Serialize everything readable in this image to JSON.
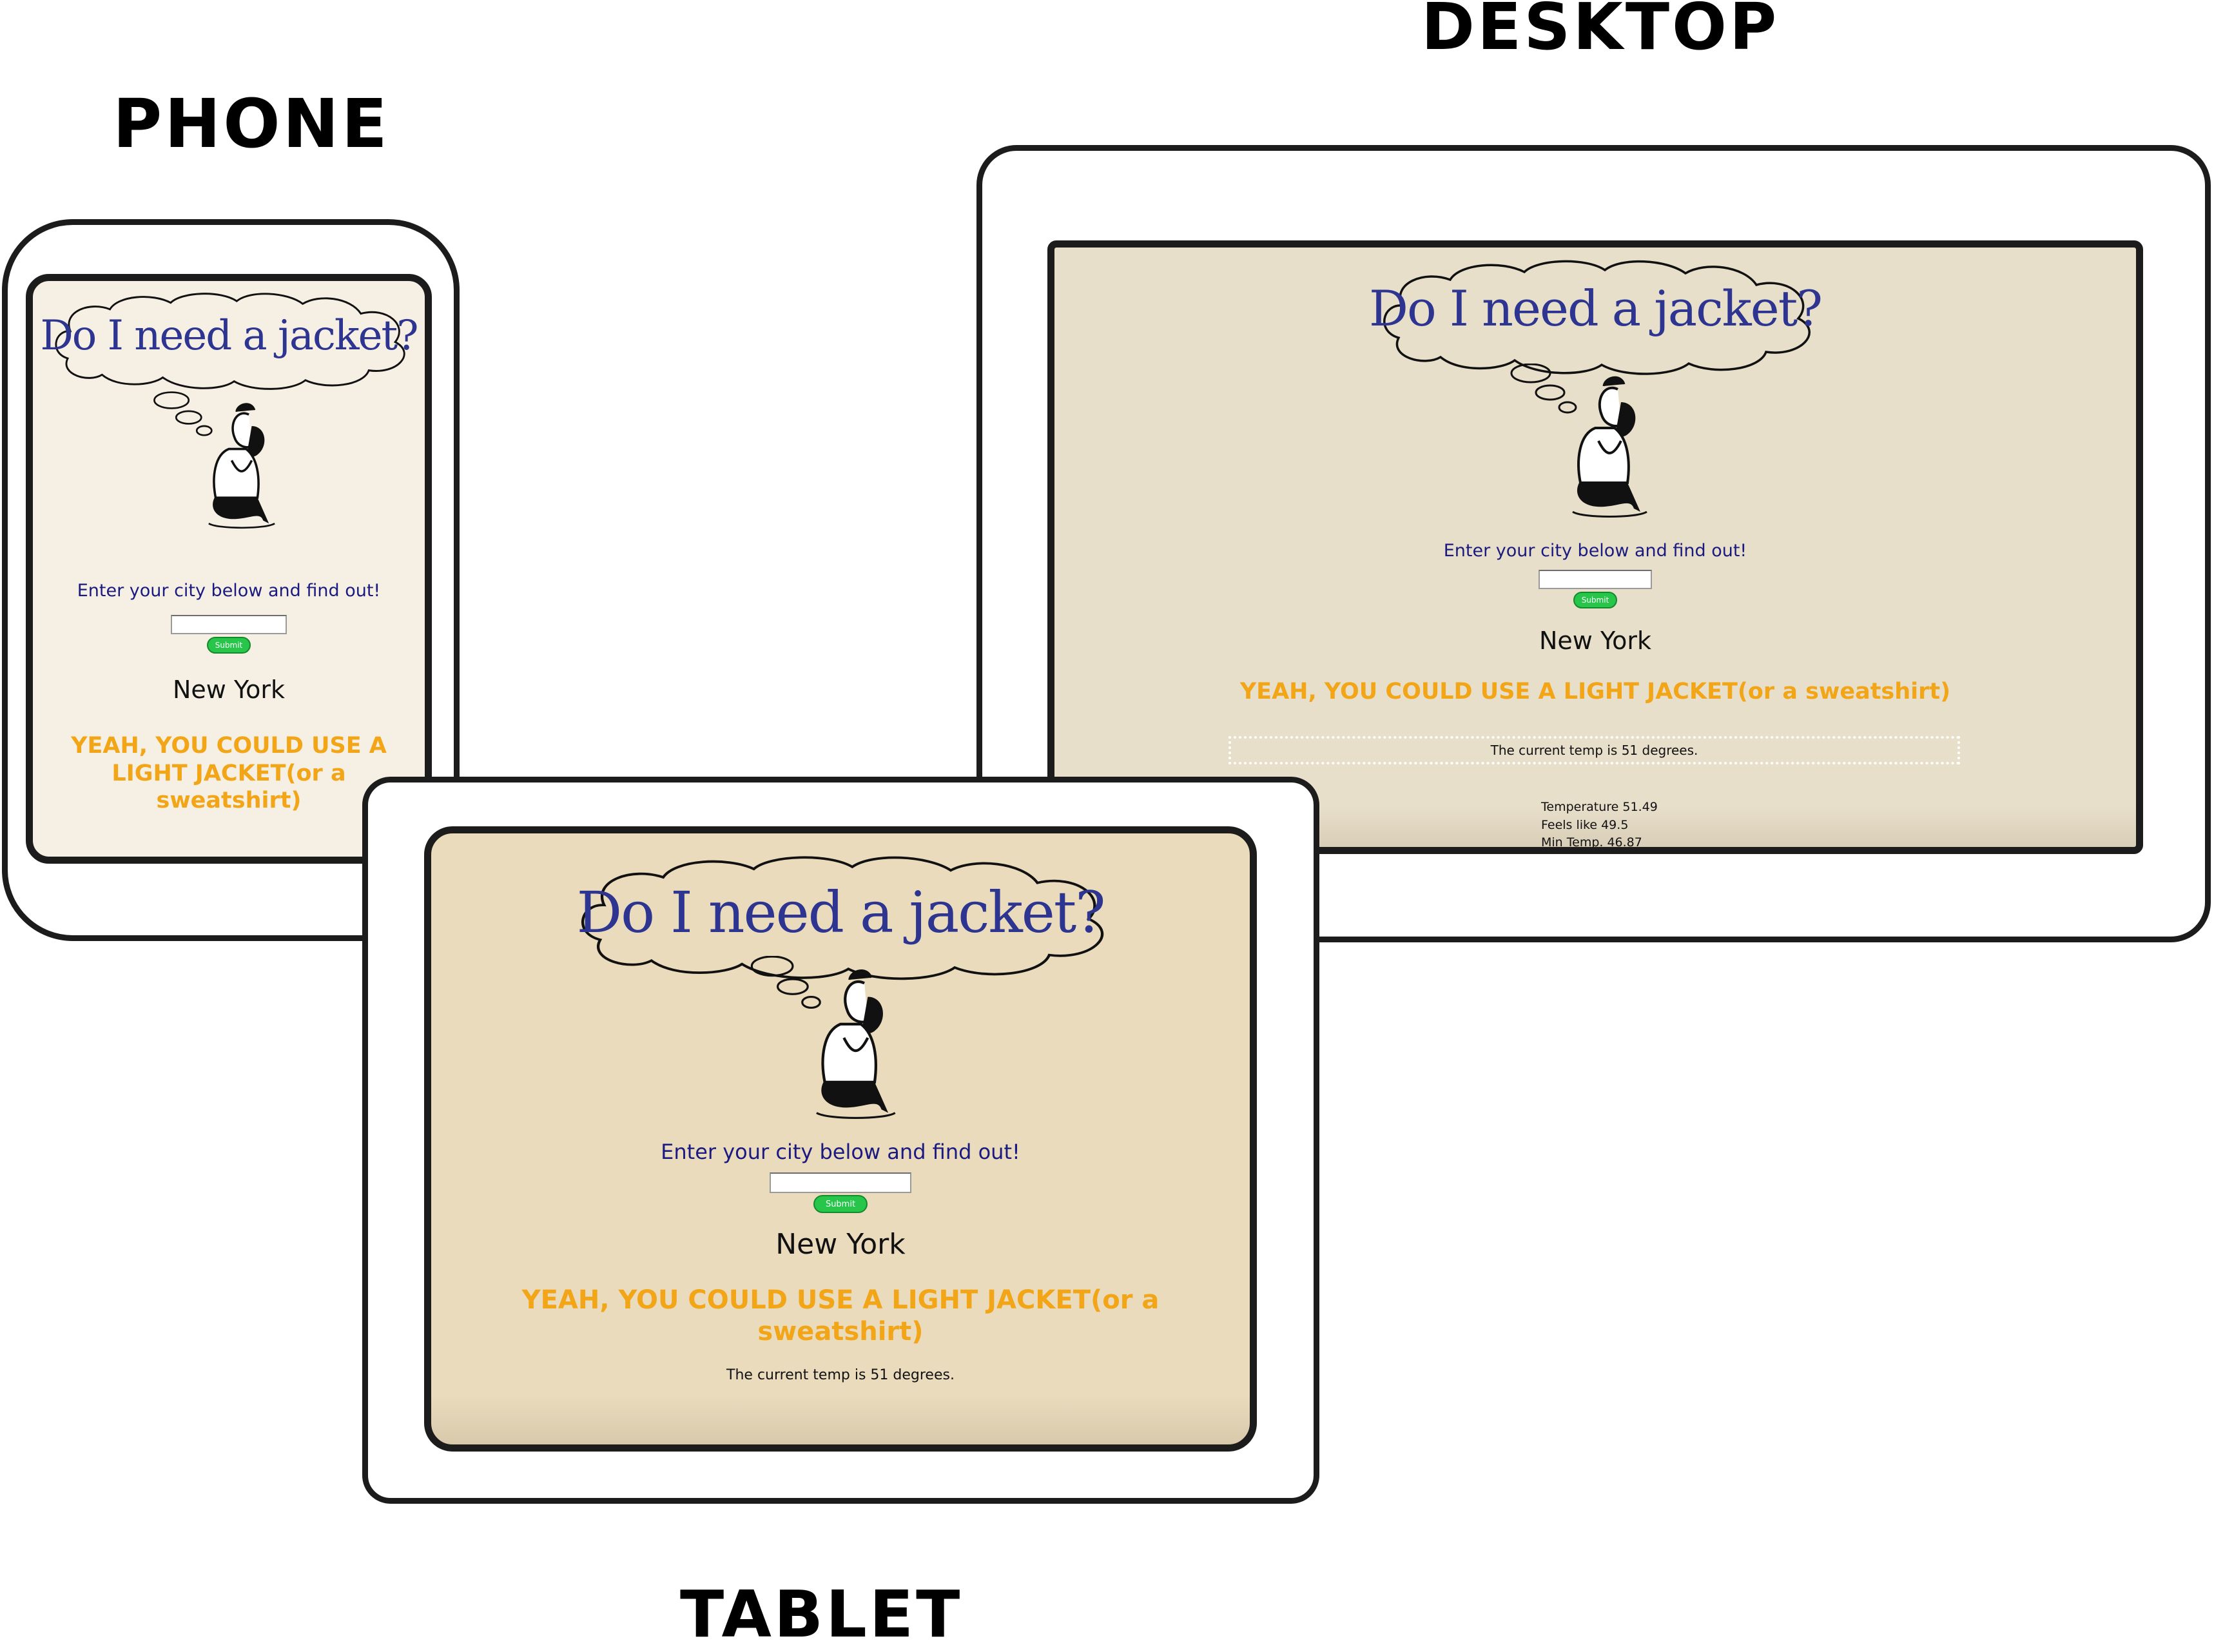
{
  "labels": {
    "phone": "PHONE",
    "desktop": "DESKTOP",
    "tablet": "TABLET"
  },
  "app": {
    "title": "Do I need a jacket?",
    "title_parts": [
      "Do",
      "I",
      "need",
      "a",
      "jacket?"
    ],
    "prompt": "Enter your city below and find out!",
    "input_value": "",
    "submit_label": "Submit",
    "city": "New York",
    "verdict": "YEAH, YOU COULD USE A LIGHT JACKET(or a sweatshirt)",
    "current_temp": "The current temp is 51 degrees.",
    "details": [
      "Temperature 51.49",
      "Feels like 49.5",
      "Min Temp. 46.87"
    ]
  },
  "colors": {
    "phone_screen_bg": "#f6f0e4",
    "tablet_screen_bg": "#eadbbd",
    "desktop_screen_bg": "#e8dfcb",
    "title_blue": "#2d3591",
    "verdict_orange": "#f2a516",
    "submit_green": "#27c54a"
  }
}
